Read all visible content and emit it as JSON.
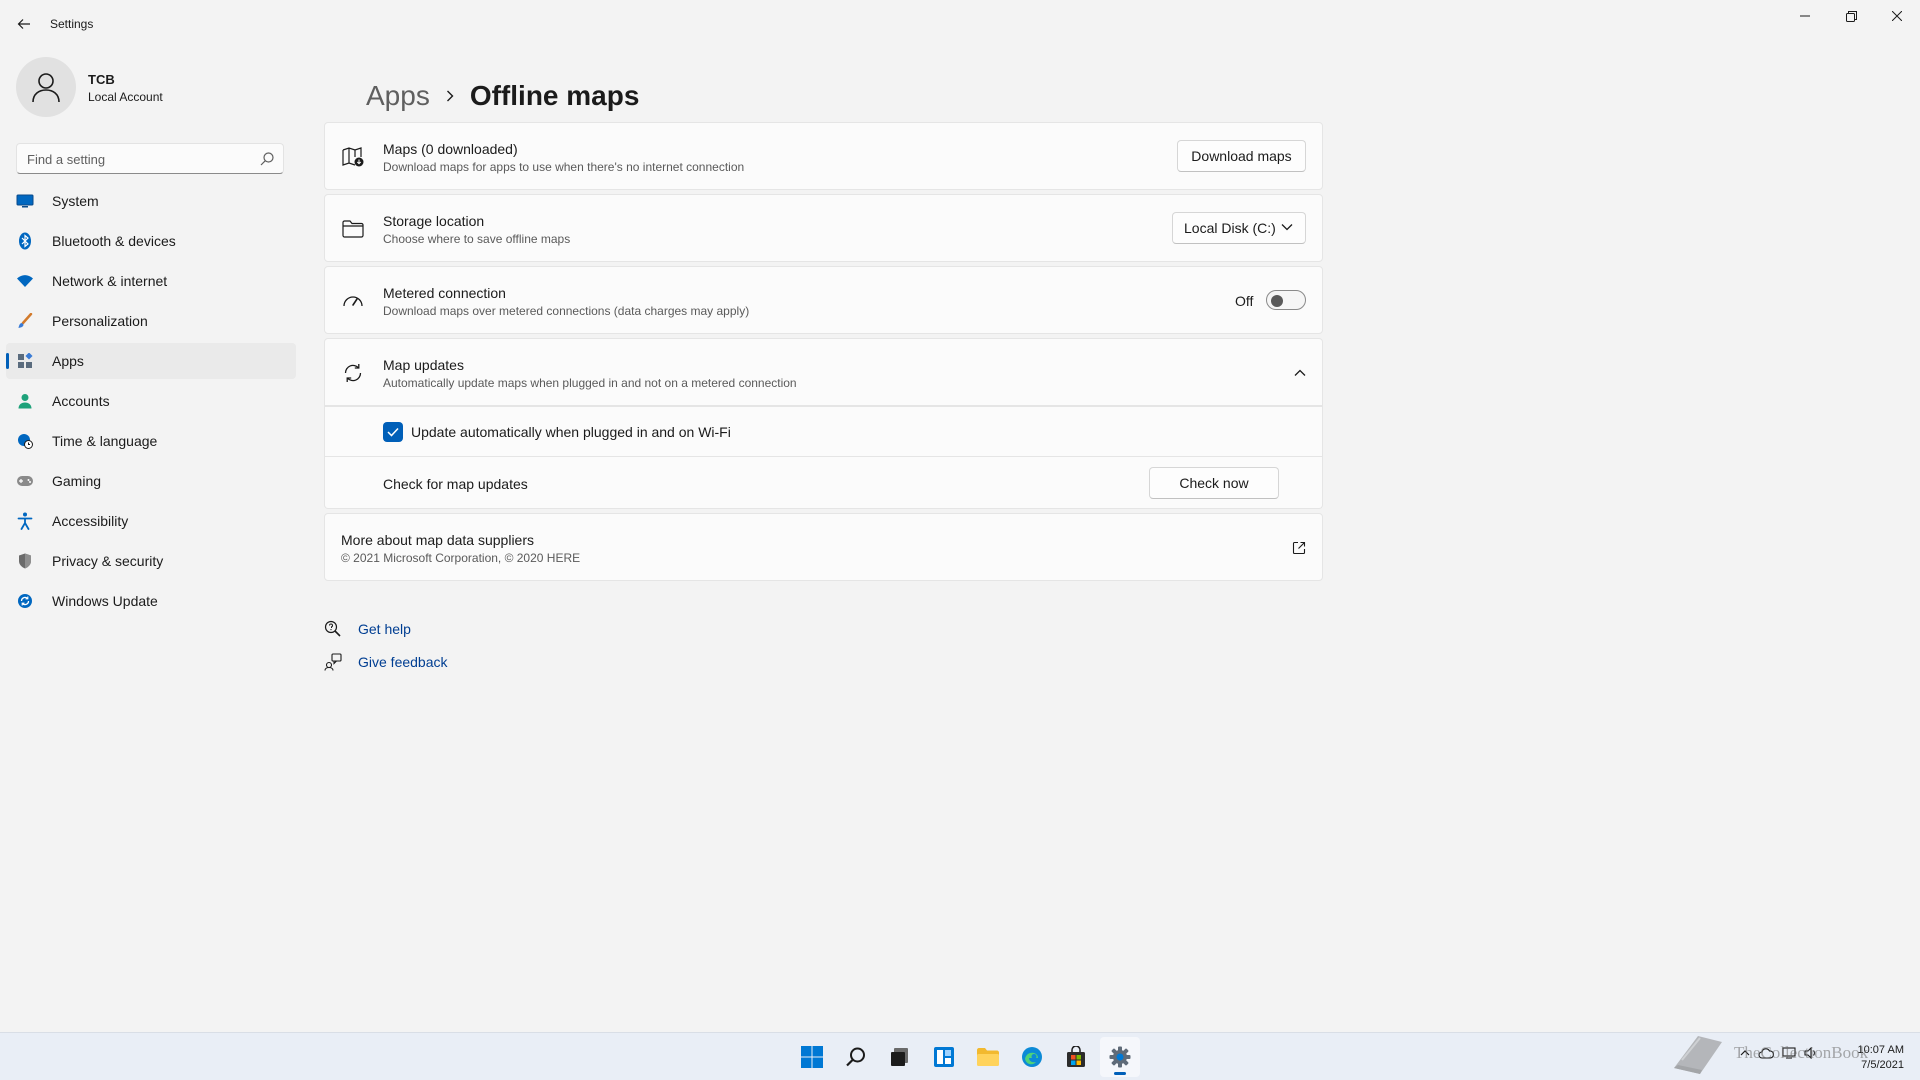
{
  "window": {
    "title": "Settings"
  },
  "profile": {
    "name": "TCB",
    "account_type": "Local Account"
  },
  "search": {
    "placeholder": "Find a setting"
  },
  "sidebar": {
    "items": [
      {
        "label": "System",
        "icon": "monitor-icon",
        "color": "#0067c0"
      },
      {
        "label": "Bluetooth & devices",
        "icon": "bluetooth-icon",
        "color": "#0067c0"
      },
      {
        "label": "Network & internet",
        "icon": "wifi-icon",
        "color": "#0067c0"
      },
      {
        "label": "Personalization",
        "icon": "brush-icon",
        "color": "#d27a2b"
      },
      {
        "label": "Apps",
        "icon": "apps-icon",
        "color": "#5a6b7d",
        "active": true
      },
      {
        "label": "Accounts",
        "icon": "person-icon",
        "color": "#1ea27a"
      },
      {
        "label": "Time & language",
        "icon": "globe-clock-icon",
        "color": "#0067c0"
      },
      {
        "label": "Gaming",
        "icon": "gamepad-icon",
        "color": "#777777"
      },
      {
        "label": "Accessibility",
        "icon": "accessibility-icon",
        "color": "#0067c0"
      },
      {
        "label": "Privacy & security",
        "icon": "shield-icon",
        "color": "#6b6b6b"
      },
      {
        "label": "Windows Update",
        "icon": "update-icon",
        "color": "#0067c0"
      }
    ]
  },
  "breadcrumb": {
    "parent": "Apps",
    "current": "Offline maps"
  },
  "cards": {
    "maps": {
      "title": "Maps (0 downloaded)",
      "description": "Download maps for apps to use when there's no internet connection",
      "button": "Download maps"
    },
    "storage": {
      "title": "Storage location",
      "description": "Choose where to save offline maps",
      "selected": "Local Disk (C:)"
    },
    "metered": {
      "title": "Metered connection",
      "description": "Download maps over metered connections (data charges may apply)",
      "state_label": "Off"
    },
    "updates": {
      "title": "Map updates",
      "description": "Automatically update maps when plugged in and not on a metered connection",
      "auto_label": "Update automatically when plugged in and on Wi-Fi",
      "check_label": "Check for map updates",
      "check_button": "Check now"
    },
    "suppliers": {
      "title": "More about map data suppliers",
      "description": "© 2021 Microsoft Corporation, © 2020 HERE"
    }
  },
  "help": {
    "get_help": "Get help",
    "give_feedback": "Give feedback"
  },
  "taskbar": {
    "time": "10:07 AM",
    "date": "7/5/2021",
    "watermark": "TheCollectionBook"
  },
  "colors": {
    "accent": "#005fb8",
    "background": "#f3f3f3",
    "card": "#fbfbfb"
  }
}
